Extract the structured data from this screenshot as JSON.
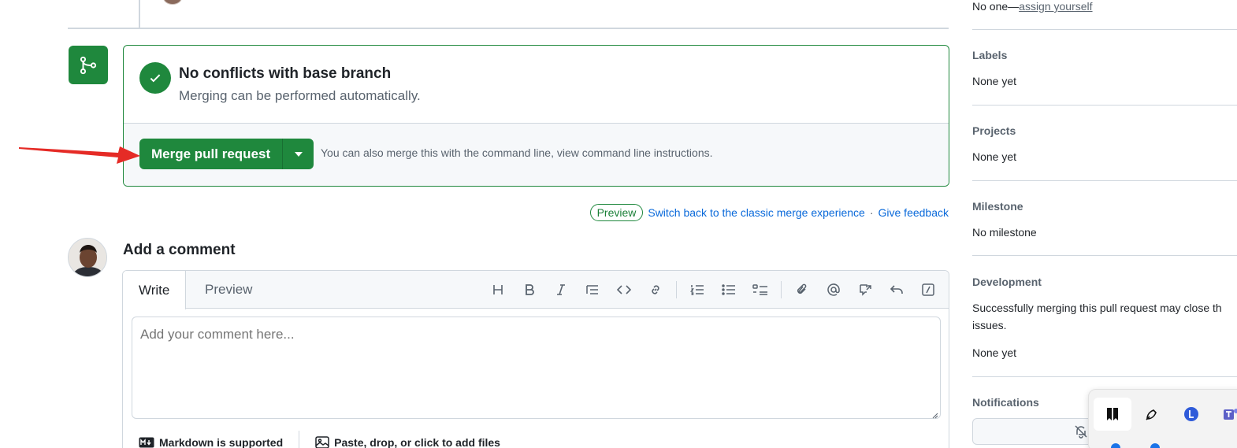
{
  "merge": {
    "status_title": "No conflicts with base branch",
    "status_subtitle": "Merging can be performed automatically.",
    "merge_button_label": "Merge pull request",
    "hint": "You can also merge this with the command line, view command line instructions."
  },
  "preview_bar": {
    "pill": "Preview",
    "switch_link": "Switch back to the classic merge experience",
    "separator": "·",
    "feedback_link": "Give feedback"
  },
  "comment": {
    "title": "Add a comment",
    "tabs": [
      "Write",
      "Preview"
    ],
    "placeholder": "Add your comment here...",
    "markdown_note": "Markdown is supported",
    "files_note": "Paste, drop, or click to add files",
    "toolbar_icons": [
      "heading-icon",
      "bold-icon",
      "italic-icon",
      "quote-icon",
      "code-icon",
      "link-icon",
      "ordered-list-icon",
      "unordered-list-icon",
      "task-list-icon",
      "attach-icon",
      "mention-icon",
      "cross-reference-icon",
      "reply-icon",
      "slash-command-icon"
    ]
  },
  "sidebar": {
    "assignees_value": "No one—",
    "assign_link": "assign yourself",
    "labels_head": "Labels",
    "labels_value": "None yet",
    "projects_head": "Projects",
    "projects_value": "None yet",
    "milestone_head": "Milestone",
    "milestone_value": "No milestone",
    "development_head": "Development",
    "development_text": "Successfully merging this pull request may close th",
    "development_text2": "issues.",
    "development_value": "None yet",
    "notifications_head": "Notifications"
  },
  "dock": {
    "apps": [
      "bookmark-app-icon",
      "pen-app-icon",
      "l-circle-app-icon",
      "teams-app-icon"
    ]
  },
  "colors": {
    "accent_green": "#1f883d",
    "link_blue": "#0969da",
    "annotation_red": "#e52b26"
  }
}
